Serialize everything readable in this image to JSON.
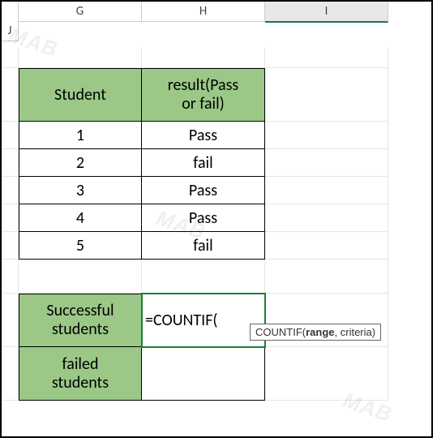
{
  "columns": {
    "G": "G",
    "H": "H",
    "I": "I",
    "J": "J"
  },
  "table1": {
    "header_student": "Student",
    "header_result_l1": "result(Pass",
    "header_result_l2": "or fail)",
    "rows": [
      {
        "n": "1",
        "r": "Pass"
      },
      {
        "n": "2",
        "r": "fail"
      },
      {
        "n": "3",
        "r": "Pass"
      },
      {
        "n": "4",
        "r": "Pass"
      },
      {
        "n": "5",
        "r": "fail"
      }
    ]
  },
  "table2": {
    "row1_l1": "Successful",
    "row1_l2": "students",
    "row1_formula": "=COUNTIF(",
    "row2_l1": "failed",
    "row2_l2": "students"
  },
  "tooltip": {
    "fn": "COUNTIF(",
    "arg1": "range",
    "rest": ", criteria)"
  },
  "wm": "MAB"
}
